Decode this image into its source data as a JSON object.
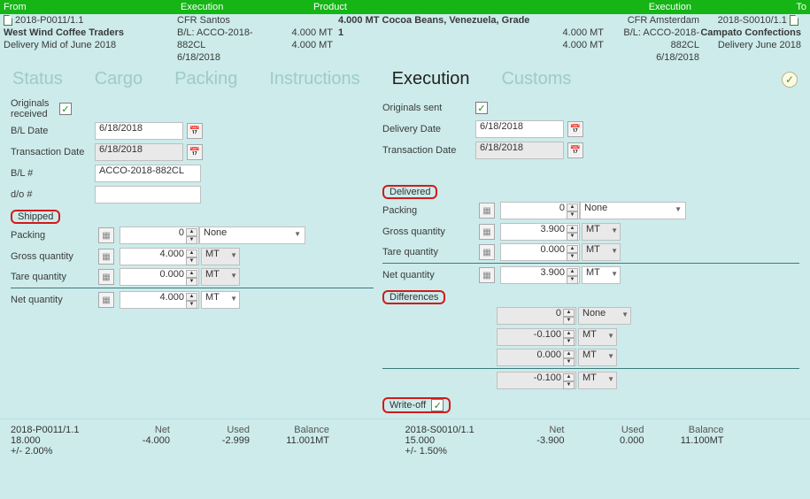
{
  "header": {
    "from": "From",
    "exec1": "Execution",
    "product": "Product",
    "exec2": "Execution",
    "to": "To"
  },
  "subhead": {
    "row1": {
      "ref_from": "2018-P0011/1.1",
      "terms_from": "CFR Santos",
      "product_line": "4.000 MT Cocoa Beans, Venezuela, Grade",
      "terms_to": "CFR Amsterdam",
      "ref_to": "2018-S0010/1.1"
    },
    "row2": {
      "party_from": "West Wind Coffee Traders",
      "bl_from": "B/L: ACCO-2018-",
      "qty_from": "4.000 MT",
      "prod2": "1",
      "qty_to": "4.000 MT",
      "bl_to": "B/L: ACCO-2018-",
      "party_to": "Campato Confections"
    },
    "row3": {
      "deliv_from": "Delivery Mid of June 2018",
      "bl_from2": "882CL",
      "qty_from2": "4.000 MT",
      "qty_to2": "4.000 MT",
      "bl_to2": "882CL",
      "deliv_to": "Delivery June 2018"
    },
    "row4": {
      "date_from": "6/18/2018",
      "date_to": "6/18/2018"
    }
  },
  "tabs": {
    "status": "Status",
    "cargo": "Cargo",
    "packing": "Packing",
    "instructions": "Instructions",
    "execution": "Execution",
    "customs": "Customs"
  },
  "left": {
    "originals_received": "Originals received",
    "bl_date_lbl": "B/L Date",
    "bl_date_val": "6/18/2018",
    "tx_date_lbl": "Transaction Date",
    "tx_date_val": "6/18/2018",
    "bl_num_lbl": "B/L #",
    "bl_num_val": "ACCO-2018-882CL",
    "do_lbl": "d/o #",
    "do_val": "",
    "shipped": "Shipped",
    "packing_lbl": "Packing",
    "packing_val": "0",
    "packing_unit": "None",
    "gross_lbl": "Gross quantity",
    "gross_val": "4.000",
    "gross_unit": "MT",
    "tare_lbl": "Tare quantity",
    "tare_val": "0.000",
    "tare_unit": "MT",
    "net_lbl": "Net quantity",
    "net_val": "4.000",
    "net_unit": "MT"
  },
  "right": {
    "originals_sent": "Originals sent",
    "deliv_date_lbl": "Delivery Date",
    "deliv_date_val": "6/18/2018",
    "tx_date_lbl": "Transaction Date",
    "tx_date_val": "6/18/2018",
    "delivered": "Delivered",
    "packing_lbl": "Packing",
    "packing_val": "0",
    "packing_unit": "None",
    "gross_lbl": "Gross quantity",
    "gross_val": "3.900",
    "gross_unit": "MT",
    "tare_lbl": "Tare quantity",
    "tare_val": "0.000",
    "tare_unit": "MT",
    "net_lbl": "Net quantity",
    "net_val": "3.900",
    "net_unit": "MT",
    "differences": "Differences",
    "diff_pack_val": "0",
    "diff_pack_unit": "None",
    "diff_gross_val": "-0.100",
    "diff_gross_unit": "MT",
    "diff_tare_val": "0.000",
    "diff_tare_unit": "MT",
    "diff_net_val": "-0.100",
    "diff_net_unit": "MT",
    "writeoff": "Write-off"
  },
  "footer": {
    "left": {
      "ref": "2018-P0011/1.1",
      "qty": "18.000",
      "tol": "+/- 2.00%",
      "net_h": "Net",
      "net_v": "-4.000",
      "used_h": "Used",
      "used_v": "-2.999",
      "bal_h": "Balance",
      "bal_v": "11.001MT"
    },
    "right": {
      "ref": "2018-S0010/1.1",
      "qty": "15.000",
      "tol": "+/- 1.50%",
      "net_h": "Net",
      "net_v": "-3.900",
      "used_h": "Used",
      "used_v": "0.000",
      "bal_h": "Balance",
      "bal_v": "11.100MT"
    }
  }
}
